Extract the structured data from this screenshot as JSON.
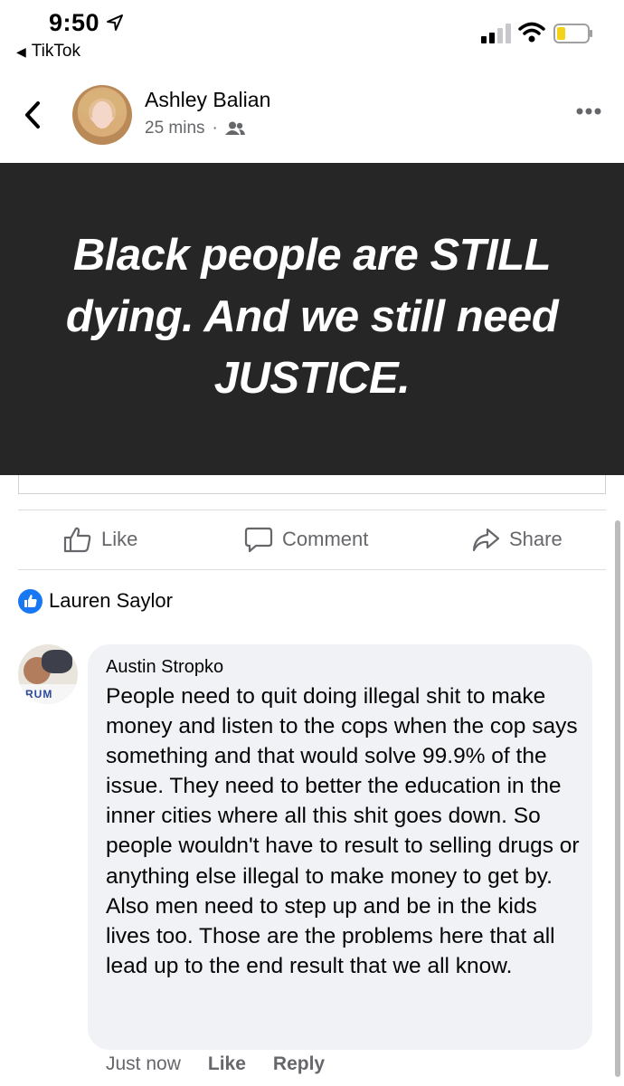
{
  "status_bar": {
    "time": "9:50",
    "back_app_label": "TikTok"
  },
  "post": {
    "author": "Ashley Balian",
    "time": "25 mins",
    "meta_separator": "·",
    "image_text": "Black people are STILL\ndying. And we still need\nJUSTICE."
  },
  "actions": {
    "like_label": "Like",
    "comment_label": "Comment",
    "share_label": "Share"
  },
  "reactions": {
    "reactor": "Lauren Saylor"
  },
  "comment": {
    "author": "Austin Stropko",
    "text": "People need to quit doing illegal shit to make money and listen to the cops when the cop says something and that would solve 99.9% of the issue. They need to better the education in the inner cities where all this shit goes down. So people wouldn't have to result to selling drugs or anything else illegal to make money to get by. Also men need to step up and be in the kids lives too. Those are the problems here that all lead up to the end result that we all know.",
    "time": "Just now",
    "like_label": "Like",
    "reply_label": "Reply"
  },
  "colors": {
    "accent": "#1877f2",
    "image_background": "#262626",
    "bubble_background": "#f0f2f5",
    "secondary_text": "#65676b"
  }
}
